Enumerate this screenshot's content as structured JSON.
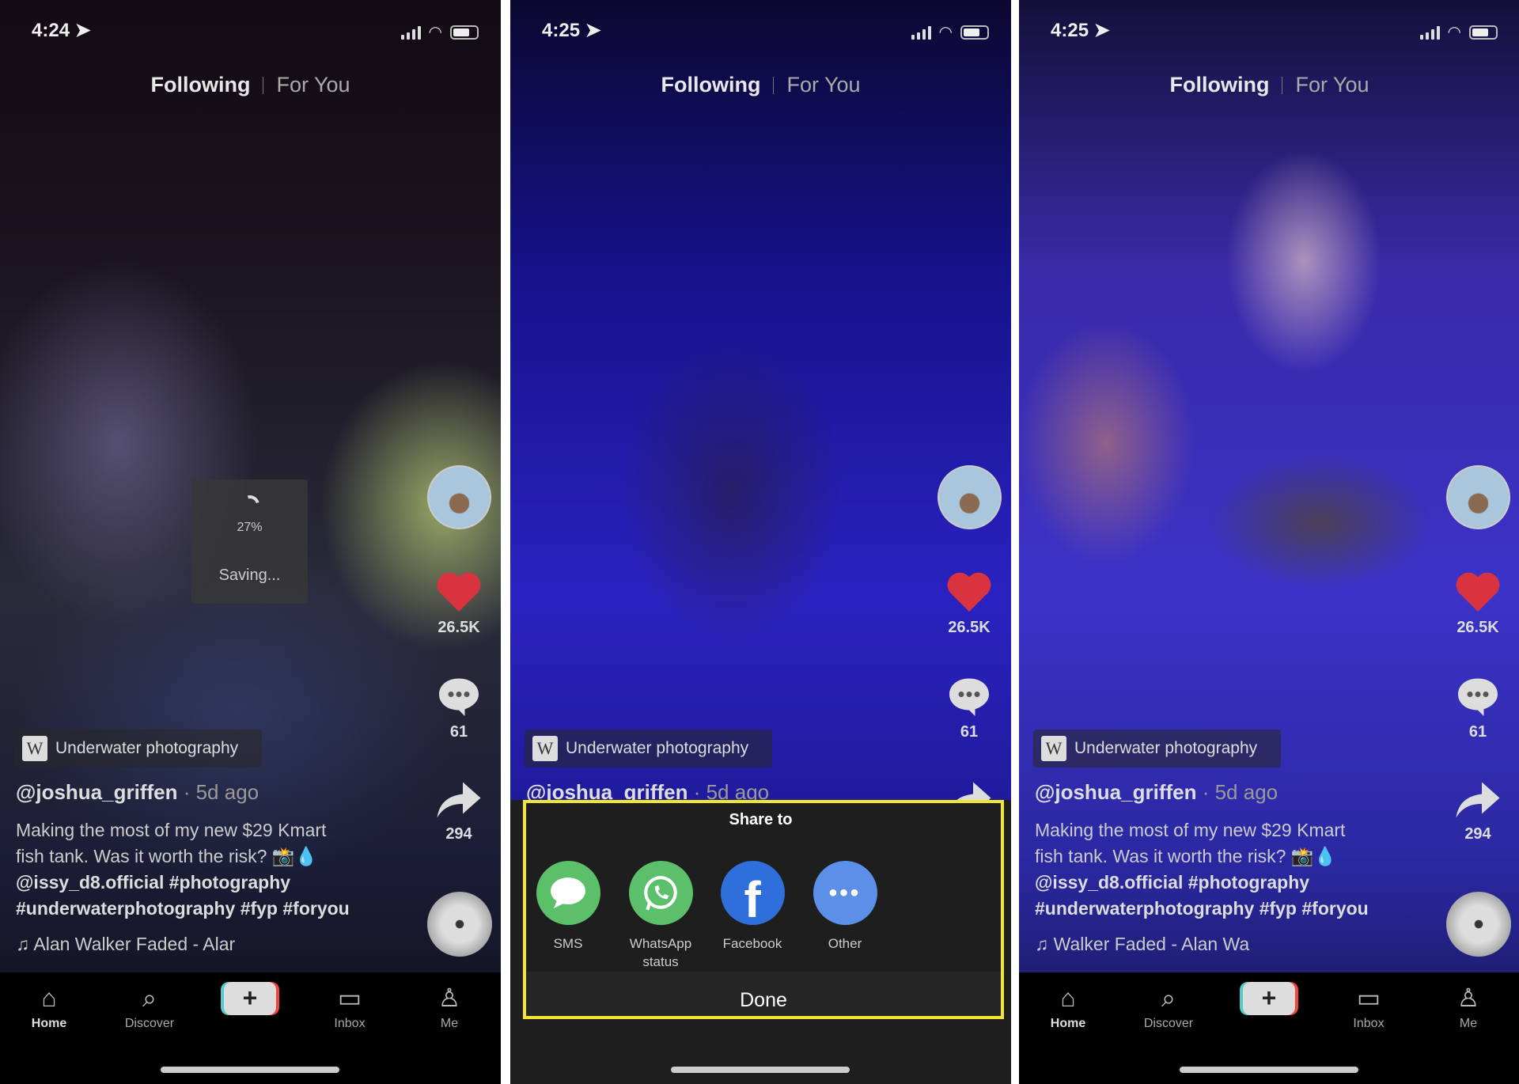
{
  "panels": [
    {
      "time": "4:24",
      "tabs": {
        "following": "Following",
        "for_you": "For You"
      },
      "likes": "26.5K",
      "comments": "61",
      "shares": "294",
      "tag": "Underwater photography",
      "tag_icon": "W",
      "username": "@joshua_griffen",
      "age": "· 5d ago",
      "caption": [
        "Making the most of my new $29 Kmart",
        "fish tank. Was it worth the risk? 📸💧"
      ],
      "mentions": "@issy_d8.official #photography",
      "hashtags": "#underwaterphotography #fyp #foryou",
      "music": "Alan Walker    Faded - Alar",
      "saving": {
        "percent": "27%",
        "label": "Saving...",
        "progress": 27
      }
    },
    {
      "time": "4:25",
      "tabs": {
        "following": "Following",
        "for_you": "For You"
      },
      "likes": "26.5K",
      "comments": "61",
      "tag": "Underwater photography",
      "tag_icon": "W",
      "username": "@joshua_griffen",
      "age": "· 5d ago"
    },
    {
      "time": "4:25",
      "tabs": {
        "following": "Following",
        "for_you": "For You"
      },
      "likes": "26.5K",
      "comments": "61",
      "shares": "294",
      "tag": "Underwater photography",
      "tag_icon": "W",
      "username": "@joshua_griffen",
      "age": "· 5d ago",
      "caption": [
        "Making the most of my new $29 Kmart",
        "fish tank. Was it worth the risk? 📸💧"
      ],
      "mentions": "@issy_d8.official #photography",
      "hashtags": "#underwaterphotography #fyp #foryou",
      "music": "Walker    Faded - Alan Wa"
    }
  ],
  "nav": {
    "home": "Home",
    "discover": "Discover",
    "inbox": "Inbox",
    "me": "Me"
  },
  "share": {
    "title": "Share to",
    "items": [
      {
        "label": "SMS",
        "color": "#5cbf6a"
      },
      {
        "label": "WhatsApp status",
        "color": "#5cbf6a"
      },
      {
        "label": "Facebook",
        "color": "#2f6fdc"
      },
      {
        "label": "Other",
        "color": "#5b8fe8"
      }
    ],
    "done": "Done",
    "highlight_color": "#f2e530"
  },
  "colors": {
    "heart": "#d8333f"
  }
}
